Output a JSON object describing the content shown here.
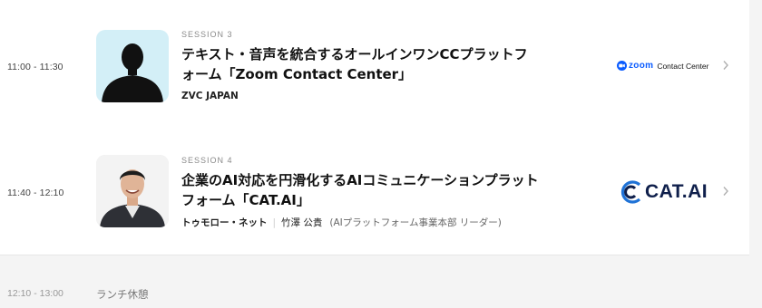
{
  "sessions": [
    {
      "time": "11:00 - 11:30",
      "label": "SESSION 3",
      "title_line1": "テキスト・音声を統合するオールインワンCCプラットフ",
      "title_line2": "ォーム「Zoom Contact Center」",
      "company": "ZVC JAPAN",
      "logo": {
        "brand_word": "zoom",
        "product": "Contact Center",
        "color": "#0b5cff",
        "icon": "zoom-camera-icon"
      }
    },
    {
      "time": "11:40 - 12:10",
      "label": "SESSION 4",
      "title_line1": "企業のAI対応を円滑化するAIコミュニケーションプラット",
      "title_line2": "フォーム「CAT.AI」",
      "speaker_org": "トゥモロー・ネット",
      "speaker_sep": "|",
      "speaker_name": "竹澤 公貴",
      "speaker_role": "(AIプラットフォーム事業本部 リーダー)",
      "logo": {
        "brand_word": "CAT.AI",
        "color": "#0f1f4b",
        "icon": "cat-ai-logo-icon"
      }
    }
  ],
  "lunch": {
    "time": "12:10 - 13:00",
    "label": "ランチ休憩"
  },
  "colors": {
    "background": "#f4f4f4",
    "card": "#ffffff",
    "silhouette_bg": "#d3eff7",
    "accent": "#0b5cff"
  }
}
